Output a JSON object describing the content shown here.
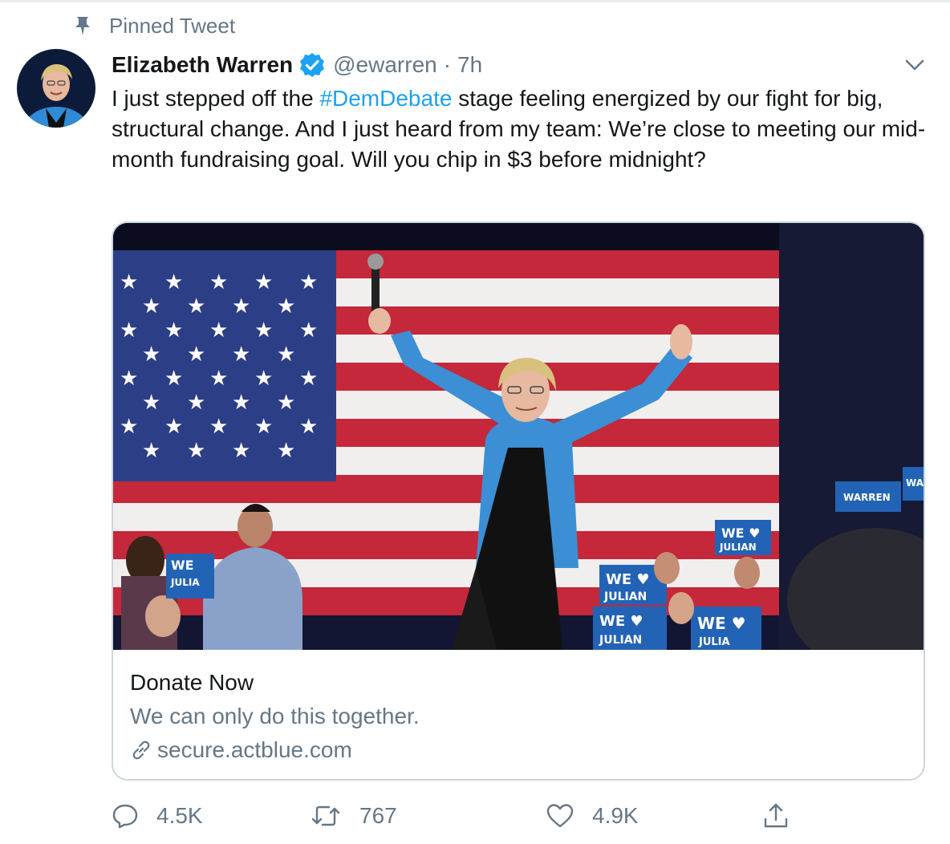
{
  "pinned": {
    "label": "Pinned Tweet",
    "icon": "pin-icon"
  },
  "author": {
    "name": "Elizabeth Warren",
    "handle": "@ewarren",
    "separator": "·",
    "time": "7h"
  },
  "tweet": {
    "text_before": "I just stepped off the ",
    "hashtag": "#DemDebate",
    "text_after": " stage feeling energized by our fight for big, structural change. And I just heard from my team: We’re close to meeting our mid-month fundraising goal. Will you chip in $3 before midnight?"
  },
  "card": {
    "title": "Donate Now",
    "description": "We can only do this together.",
    "domain": "secure.actblue.com"
  },
  "actions": {
    "reply_count": "4.5K",
    "retweet_count": "767",
    "like_count": "4.9K"
  },
  "colors": {
    "accent": "#1da1f2",
    "secondary_text": "#657786",
    "border": "#ccd6dd"
  }
}
